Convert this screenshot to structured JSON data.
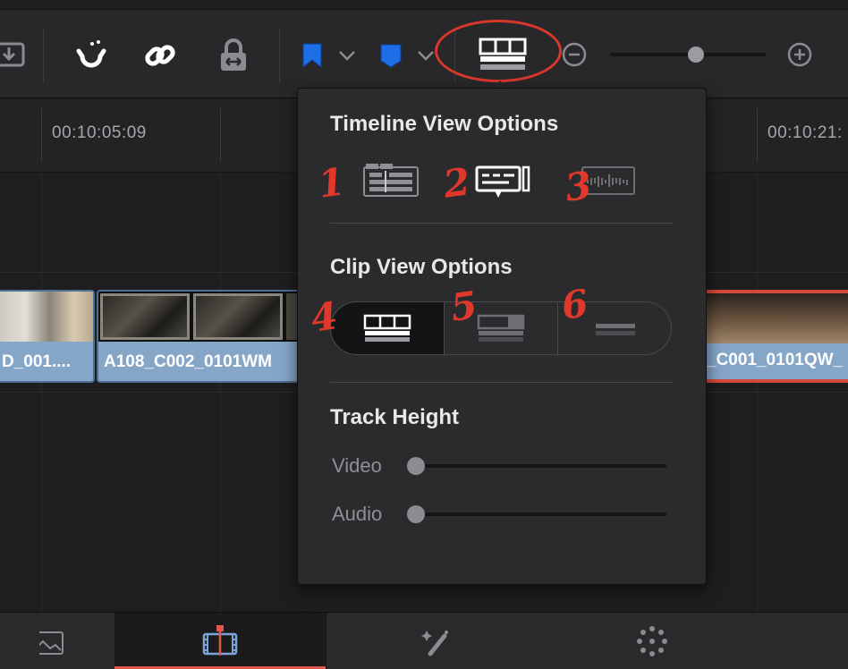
{
  "timeline": {
    "timecodes": [
      "00:10:05:09",
      "00:10:21:"
    ],
    "clips": [
      {
        "label": "D_001...."
      },
      {
        "label": "A108_C002_0101WM"
      },
      {
        "label": "_C001_0101QW_"
      }
    ]
  },
  "popup": {
    "timeline_view_title": "Timeline View Options",
    "clip_view_title": "Clip View Options",
    "track_height_title": "Track Height",
    "video_label": "Video",
    "audio_label": "Audio",
    "video_height": 0,
    "audio_height": 0
  },
  "annotations": [
    "1",
    "2",
    "3",
    "4",
    "5",
    "6"
  ],
  "toolbar": {
    "zoom_level": 0.55
  },
  "colors": {
    "accent_red": "#e2574c",
    "flag_blue": "#1e6ee8",
    "clip_blue": "#86a6c8"
  }
}
